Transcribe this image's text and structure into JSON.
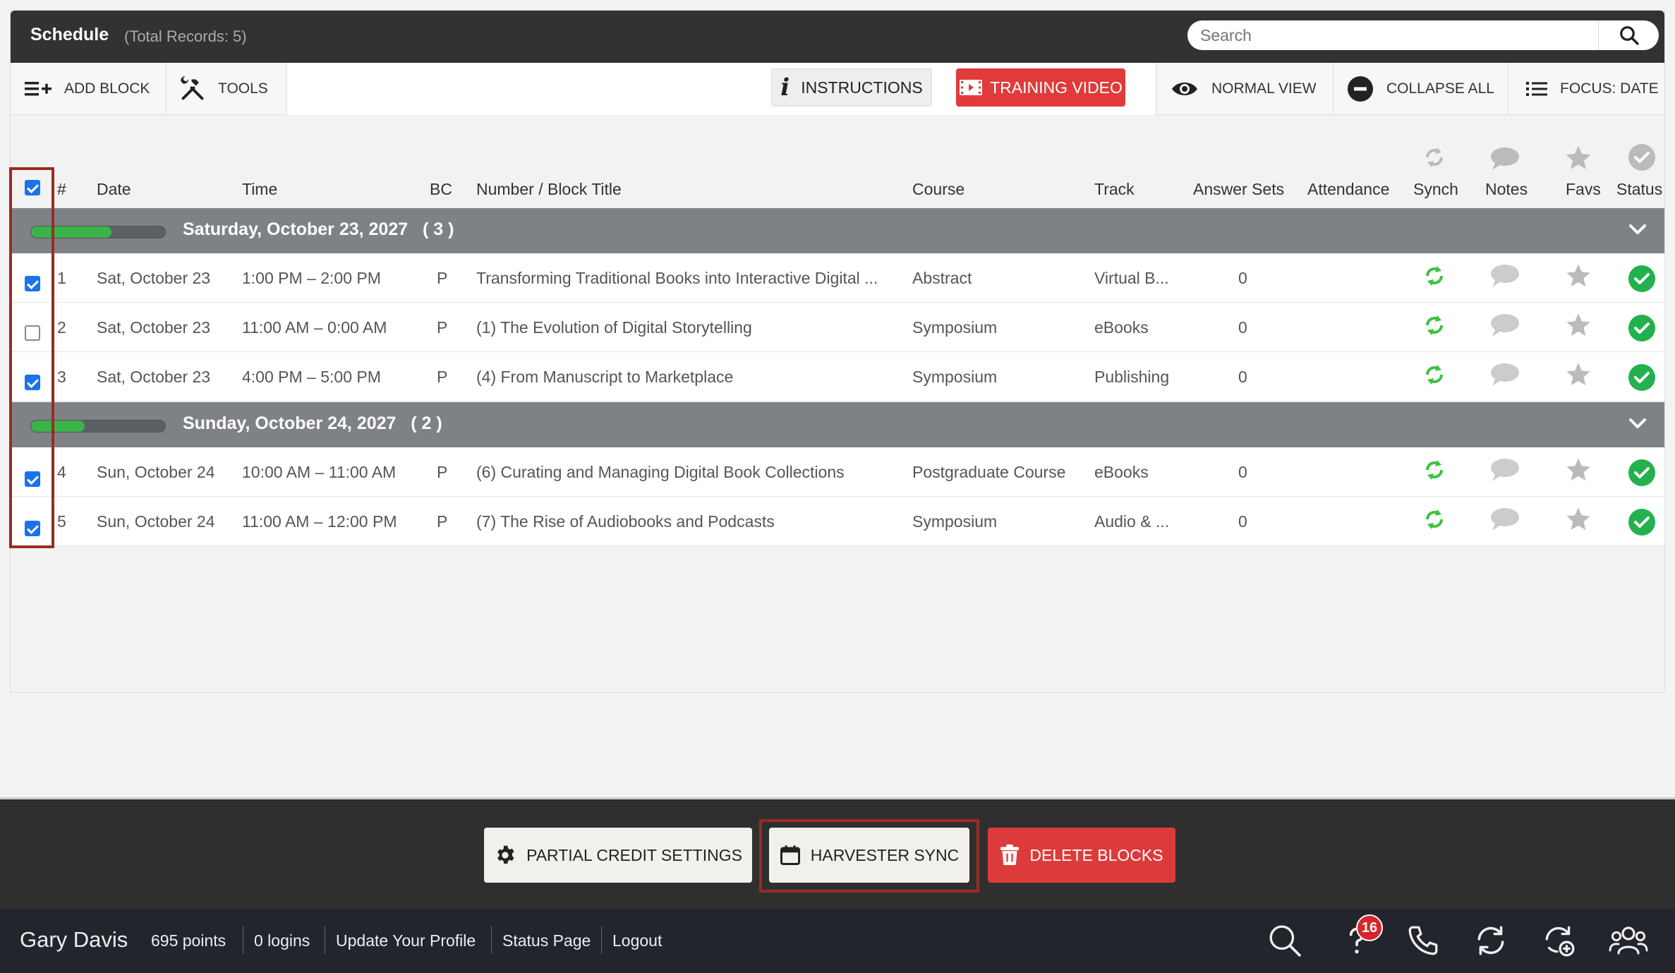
{
  "header": {
    "title": "Schedule",
    "subtitle": "(Total Records: 5)",
    "search_placeholder": "Search"
  },
  "toolbar": {
    "add_block": "ADD BLOCK",
    "tools": "TOOLS",
    "instructions": "INSTRUCTIONS",
    "training_video": "TRAINING VIDEO",
    "normal_view": "NORMAL VIEW",
    "collapse_all": "COLLAPSE ALL",
    "focus": "FOCUS: DATE"
  },
  "table": {
    "columns": {
      "num": "#",
      "date": "Date",
      "time": "Time",
      "bc": "BC",
      "title": "Number / Block Title",
      "course": "Course",
      "track": "Track",
      "answer_sets": "Answer Sets",
      "attendance": "Attendance",
      "synch": "Synch",
      "notes": "Notes",
      "favs": "Favs",
      "status": "Status"
    },
    "groups": [
      {
        "title": "Saturday, October 23, 2027   ( 3 )",
        "progress": 0.6,
        "rows": [
          {
            "checked": true,
            "num": "1",
            "date": "Sat, October 23",
            "time": "1:00 PM – 2:00 PM",
            "bc": "P",
            "title": "Transforming Traditional Books into Interactive Digital ...",
            "course": "Abstract",
            "track": "Virtual B...",
            "answer_sets": "0"
          },
          {
            "checked": false,
            "num": "2",
            "date": "Sat, October 23",
            "time": "11:00 AM – 0:00 AM",
            "bc": "P",
            "title": "(1) The Evolution of Digital Storytelling",
            "course": "Symposium",
            "track": "eBooks",
            "answer_sets": "0"
          },
          {
            "checked": true,
            "num": "3",
            "date": "Sat, October 23",
            "time": "4:00 PM – 5:00 PM",
            "bc": "P",
            "title": "(4) From Manuscript to Marketplace",
            "course": "Symposium",
            "track": "Publishing",
            "answer_sets": "0"
          }
        ]
      },
      {
        "title": "Sunday, October 24, 2027   ( 2 )",
        "progress": 0.4,
        "rows": [
          {
            "checked": true,
            "num": "4",
            "date": "Sun, October 24",
            "time": "10:00 AM – 11:00 AM",
            "bc": "P",
            "title": "(6) Curating and Managing Digital Book Collections",
            "course": "Postgraduate Course",
            "track": "eBooks",
            "answer_sets": "0"
          },
          {
            "checked": true,
            "num": "5",
            "date": "Sun, October 24",
            "time": "11:00 AM – 12:00 PM",
            "bc": "P",
            "title": "(7) The Rise of Audiobooks and Podcasts",
            "course": "Symposium",
            "track": "Audio & ...",
            "answer_sets": "0"
          }
        ]
      }
    ]
  },
  "actions": {
    "partial_credit": "PARTIAL CREDIT SETTINGS",
    "harvester_sync": "HARVESTER SYNC",
    "delete_blocks": "DELETE BLOCKS"
  },
  "footer": {
    "user_name": "Gary Davis",
    "points": "695 points",
    "logins": "0 logins",
    "update_profile": "Update Your Profile",
    "status_page": "Status Page",
    "logout": "Logout",
    "help_badge": "16"
  },
  "colors": {
    "header_bg": "#323232",
    "group_bg": "#7e8287",
    "accent_red": "#dd3b3b",
    "sync_green": "#3ec23e",
    "status_green": "#22b14c",
    "checkbox_blue": "#1a73e8",
    "highlight": "#9a2b22"
  }
}
